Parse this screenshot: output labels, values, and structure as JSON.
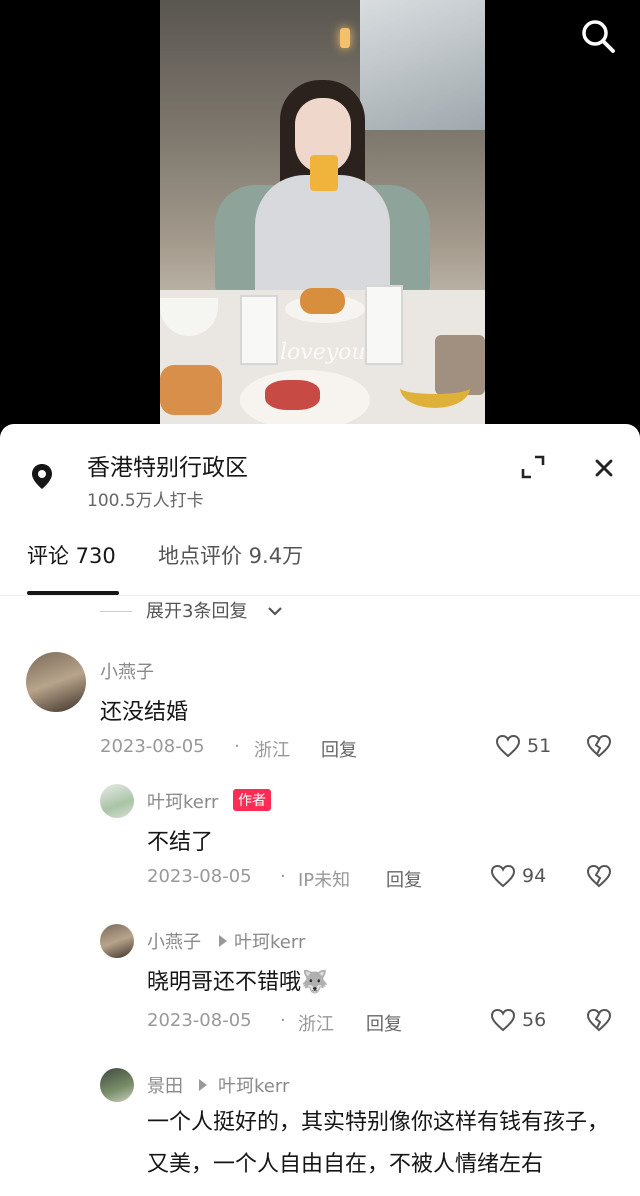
{
  "location": {
    "title": "香港特别行政区",
    "checkins": "100.5万人打卡"
  },
  "tabs": [
    {
      "label": "评论 730",
      "active": true
    },
    {
      "label": "地点评价 9.4万",
      "active": false
    }
  ],
  "expand_replies": "展开3条回复",
  "comments": [
    {
      "user": "小燕子",
      "text": "还没结婚",
      "date": "2023-08-05",
      "region": "浙江",
      "reply_label": "回复",
      "likes": "51"
    },
    {
      "user": "叶珂kerr",
      "badge": "作者",
      "text": "不结了",
      "date": "2023-08-05",
      "region": "IP未知",
      "reply_label": "回复",
      "likes": "94"
    },
    {
      "user": "小燕子",
      "reply_to": "叶珂kerr",
      "text": "晓明哥还不错哦🐺",
      "date": "2023-08-05",
      "region": "浙江",
      "reply_label": "回复",
      "likes": "56"
    },
    {
      "user": "景田",
      "reply_to": "叶珂kerr",
      "text": "一个人挺好的，其实特别像你这样有钱有孩子，又美，一个人自由自在，不被人情绪左右"
    }
  ],
  "video": {
    "watermark": "loveyou"
  },
  "colors": {
    "author_badge": "#fe2c55",
    "sheet_bg": "#ffffff",
    "text_primary": "#161616",
    "text_secondary": "#8a8a8a"
  }
}
